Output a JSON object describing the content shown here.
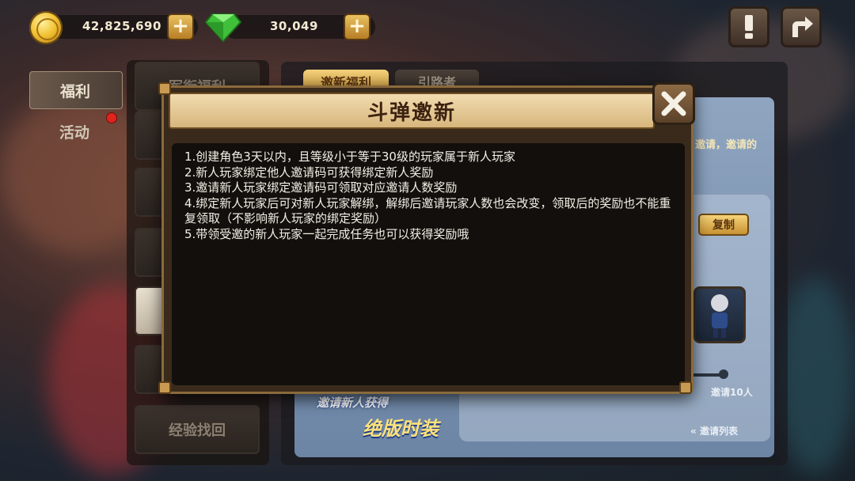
{
  "currency": {
    "gold_amount": "42,825,690",
    "diamond_amount": "30,049",
    "plus_symbol": "+"
  },
  "top_buttons": {
    "notice_icon": "exclamation-icon",
    "share_icon": "share-arrow-icon"
  },
  "left_nav": {
    "items": [
      {
        "label": "福利",
        "active": true
      },
      {
        "label": "活动",
        "active": false,
        "has_dot": true
      }
    ]
  },
  "mid_list": {
    "items": [
      {
        "label": "军衔福利"
      },
      {
        "label": ""
      },
      {
        "label": ""
      },
      {
        "label": ""
      },
      {
        "label": ""
      },
      {
        "label": ""
      },
      {
        "label": "经验找回"
      }
    ]
  },
  "right_panel": {
    "tabs": [
      {
        "label": "邀新福利",
        "active": true
      },
      {
        "label": "引路者",
        "active": false
      }
    ],
    "partial_text": "邀请，邀请的",
    "copy_button": "复制",
    "invite_count_label": "邀请10人",
    "invite_list_link": "邀请列表",
    "banner_line1": "邀请新人获得",
    "banner_line2": "绝版时装"
  },
  "modal": {
    "title": "斗弹邀新",
    "close_icon": "close-x-icon",
    "rules": [
      "1.创建角色3天以内，且等级小于等于30级的玩家属于新人玩家",
      "2.新人玩家绑定他人邀请码可获得绑定新人奖励",
      "3.邀请新人玩家绑定邀请码可领取对应邀请人数奖励",
      "4.绑定新人玩家后可对新人玩家解绑，解绑后邀请玩家人数也会改变，领取后的奖励也不能重复领取（不影响新人玩家的绑定奖励）",
      "5.带领受邀的新人玩家一起完成任务也可以获得奖励哦"
    ]
  },
  "colors": {
    "modal_header": "#e6c890",
    "modal_body": "#120f0c",
    "gold_button": "#d9a63f",
    "red_dot": "#e0241d"
  }
}
